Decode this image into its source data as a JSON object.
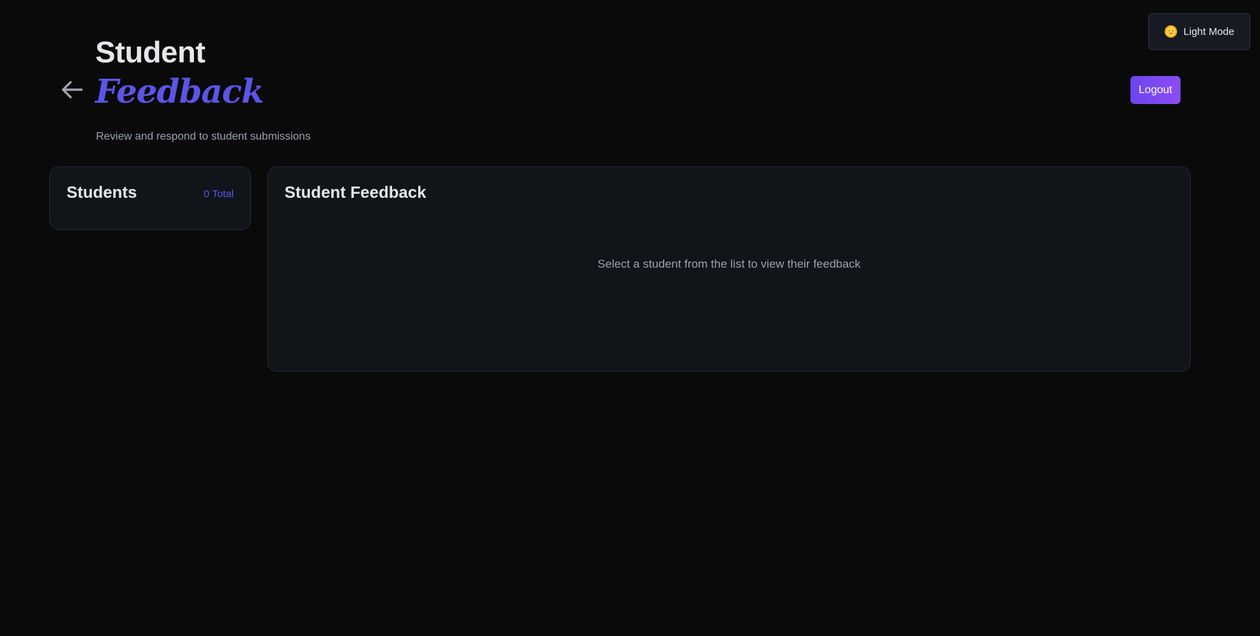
{
  "theme_toggle": {
    "label": "Light Mode",
    "icon": "sun-icon"
  },
  "header": {
    "title_line1": "Student",
    "title_line2": "Feedback",
    "subtitle": "Review and respond to student submissions",
    "back_icon": "arrow-left-icon",
    "logout_label": "Logout"
  },
  "students_panel": {
    "title": "Students",
    "total_badge": "0 Total"
  },
  "feedback_panel": {
    "title": "Student Feedback",
    "empty_message": "Select a student from the list to view their feedback"
  },
  "colors": {
    "background": "#0a0a0b",
    "panel": "#111419",
    "accent": "#5b55e6",
    "button_gradient_start": "#6b45ef",
    "button_gradient_end": "#8b4cf3"
  }
}
